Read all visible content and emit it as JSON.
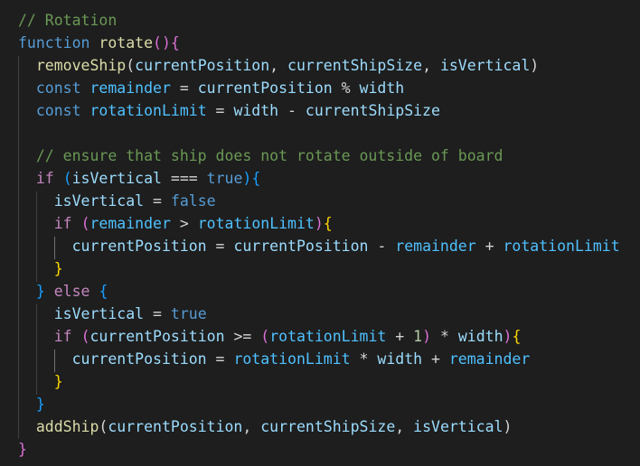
{
  "colors": {
    "background": "#1e1e1e",
    "comment": "#6a9955",
    "keyword": "#569cd6",
    "control": "#c586c0",
    "function": "#dcdcaa",
    "variable": "#9cdcfe",
    "constant": "#4fc1ff",
    "number": "#b5cea8",
    "text": "#d4d4d4",
    "bracket_gold": "#ffd700",
    "bracket_pink": "#da70d6",
    "bracket_blue": "#179fff"
  },
  "editor": {
    "lines": [
      [
        {
          "t": "// Rotation",
          "c": "comment"
        }
      ],
      [
        {
          "t": "function",
          "c": "keyword"
        },
        {
          "t": " "
        },
        {
          "t": "rotate",
          "c": "func"
        },
        {
          "t": "()",
          "c": "b2"
        },
        {
          "t": "{",
          "c": "b2"
        }
      ],
      [
        {
          "t": "  "
        },
        {
          "t": "removeShip",
          "c": "func"
        },
        {
          "t": "("
        },
        {
          "t": "currentPosition",
          "c": "var"
        },
        {
          "t": ", "
        },
        {
          "t": "currentShipSize",
          "c": "var"
        },
        {
          "t": ", "
        },
        {
          "t": "isVertical",
          "c": "var"
        },
        {
          "t": ")"
        }
      ],
      [
        {
          "t": "  "
        },
        {
          "t": "const",
          "c": "keyword"
        },
        {
          "t": " "
        },
        {
          "t": "remainder",
          "c": "const"
        },
        {
          "t": " = "
        },
        {
          "t": "currentPosition",
          "c": "var"
        },
        {
          "t": " % "
        },
        {
          "t": "width",
          "c": "var"
        }
      ],
      [
        {
          "t": "  "
        },
        {
          "t": "const",
          "c": "keyword"
        },
        {
          "t": " "
        },
        {
          "t": "rotationLimit",
          "c": "const"
        },
        {
          "t": " = "
        },
        {
          "t": "width",
          "c": "var"
        },
        {
          "t": " - "
        },
        {
          "t": "currentShipSize",
          "c": "var"
        }
      ],
      [],
      [
        {
          "t": "  "
        },
        {
          "t": "// ensure that ship does not rotate outside of board",
          "c": "comment"
        }
      ],
      [
        {
          "t": "  "
        },
        {
          "t": "if",
          "c": "control"
        },
        {
          "t": " "
        },
        {
          "t": "(",
          "c": "b3"
        },
        {
          "t": "isVertical",
          "c": "var"
        },
        {
          "t": " === "
        },
        {
          "t": "true",
          "c": "keyword"
        },
        {
          "t": ")",
          "c": "b3"
        },
        {
          "t": "{",
          "c": "b3"
        }
      ],
      [
        {
          "t": "    "
        },
        {
          "t": "isVertical",
          "c": "var"
        },
        {
          "t": " = "
        },
        {
          "t": "false",
          "c": "keyword"
        }
      ],
      [
        {
          "t": "    "
        },
        {
          "t": "if",
          "c": "control"
        },
        {
          "t": " "
        },
        {
          "t": "(",
          "c": "b2"
        },
        {
          "t": "remainder",
          "c": "const"
        },
        {
          "t": " > "
        },
        {
          "t": "rotationLimit",
          "c": "const"
        },
        {
          "t": ")",
          "c": "b2"
        },
        {
          "t": "{",
          "c": "b1"
        }
      ],
      [
        {
          "t": "      "
        },
        {
          "t": "currentPosition",
          "c": "var"
        },
        {
          "t": " = "
        },
        {
          "t": "currentPosition",
          "c": "var"
        },
        {
          "t": " - "
        },
        {
          "t": "remainder",
          "c": "const"
        },
        {
          "t": " + "
        },
        {
          "t": "rotationLimit",
          "c": "const"
        }
      ],
      [
        {
          "t": "    "
        },
        {
          "t": "}",
          "c": "b1"
        }
      ],
      [
        {
          "t": "  "
        },
        {
          "t": "}",
          "c": "b3"
        },
        {
          "t": " "
        },
        {
          "t": "else",
          "c": "control"
        },
        {
          "t": " "
        },
        {
          "t": "{",
          "c": "b3"
        }
      ],
      [
        {
          "t": "    "
        },
        {
          "t": "isVertical",
          "c": "var"
        },
        {
          "t": " = "
        },
        {
          "t": "true",
          "c": "keyword"
        }
      ],
      [
        {
          "t": "    "
        },
        {
          "t": "if",
          "c": "control"
        },
        {
          "t": " "
        },
        {
          "t": "(",
          "c": "b2"
        },
        {
          "t": "currentPosition",
          "c": "var"
        },
        {
          "t": " >= "
        },
        {
          "t": "(",
          "c": "b2"
        },
        {
          "t": "rotationLimit",
          "c": "const"
        },
        {
          "t": " + "
        },
        {
          "t": "1",
          "c": "number"
        },
        {
          "t": ")",
          "c": "b2"
        },
        {
          "t": " * "
        },
        {
          "t": "width",
          "c": "var"
        },
        {
          "t": ")",
          "c": "b2"
        },
        {
          "t": "{",
          "c": "b1"
        }
      ],
      [
        {
          "t": "      "
        },
        {
          "t": "currentPosition",
          "c": "var"
        },
        {
          "t": " = "
        },
        {
          "t": "rotationLimit",
          "c": "const"
        },
        {
          "t": " * "
        },
        {
          "t": "width",
          "c": "var"
        },
        {
          "t": " + "
        },
        {
          "t": "remainder",
          "c": "const"
        }
      ],
      [
        {
          "t": "    "
        },
        {
          "t": "}",
          "c": "b1"
        }
      ],
      [
        {
          "t": "  "
        },
        {
          "t": "}",
          "c": "b3"
        }
      ],
      [
        {
          "t": "  "
        },
        {
          "t": "addShip",
          "c": "func"
        },
        {
          "t": "("
        },
        {
          "t": "currentPosition",
          "c": "var"
        },
        {
          "t": ", "
        },
        {
          "t": "currentShipSize",
          "c": "var"
        },
        {
          "t": ", "
        },
        {
          "t": "isVertical",
          "c": "var"
        },
        {
          "t": ")"
        }
      ],
      [
        {
          "t": "}",
          "c": "b2"
        }
      ]
    ]
  }
}
